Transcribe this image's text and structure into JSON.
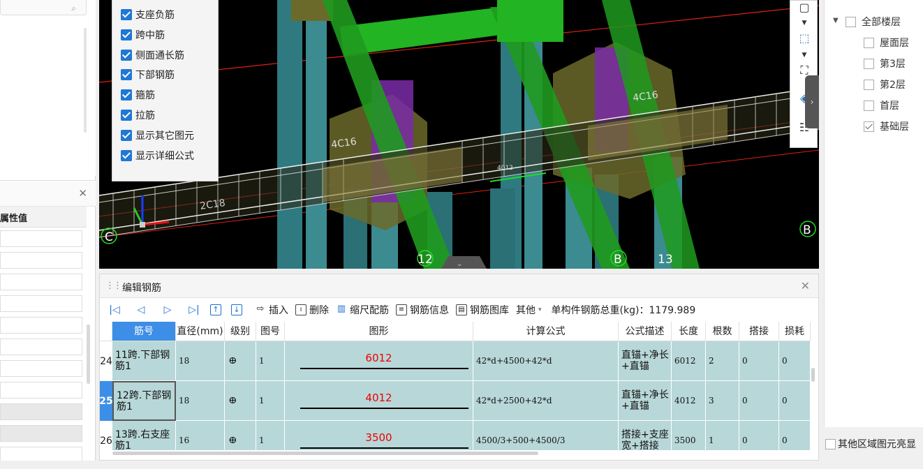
{
  "visibility_options": [
    "支座负筋",
    "跨中筋",
    "侧面通长筋",
    "下部钢筋",
    "箍筋",
    "拉筋",
    "显示其它图元",
    "显示详细公式"
  ],
  "properties_panel": {
    "column_header": "属性值"
  },
  "viewport": {
    "labels": {
      "rebar_top_left": "4C16",
      "rebar_top_right": "4C16",
      "rebar_bottom": "2C18",
      "mid_label": "4012",
      "axis_c": "C",
      "axis_b_right": "B",
      "axis_12": "12",
      "axis_b": "B",
      "axis_13": "13"
    }
  },
  "floor_tree": {
    "root": "全部楼层",
    "floors": [
      {
        "label": "屋面层",
        "checked": false
      },
      {
        "label": "第3层",
        "checked": false
      },
      {
        "label": "第2层",
        "checked": false
      },
      {
        "label": "首层",
        "checked": false
      },
      {
        "label": "基础层",
        "checked": true
      }
    ],
    "bottom_option": "其他区域图元亮显"
  },
  "rebar_panel": {
    "title": "编辑钢筋",
    "toolbar": {
      "insert": "插入",
      "delete": "删除",
      "scale": "缩尺配筋",
      "info": "钢筋信息",
      "library": "钢筋图库",
      "other": "其他",
      "total_weight": "单构件钢筋总重(kg)：1179.989"
    },
    "columns": [
      "筋号",
      "直径(mm)",
      "级别",
      "图号",
      "图形",
      "计算公式",
      "公式描述",
      "长度",
      "根数",
      "搭接",
      "损耗"
    ],
    "rows": [
      {
        "num": "24",
        "name": "11跨.下部钢筋1",
        "diameter": "18",
        "grade": "ⴲ",
        "fig": "1",
        "shape": "6012",
        "formula": "42*d+4500+42*d",
        "desc": "直锚+净长+直锚",
        "length": "6012",
        "count": "2",
        "lap": "0",
        "loss": "0"
      },
      {
        "num": "25",
        "name": "12跨.下部钢筋1",
        "diameter": "18",
        "grade": "ⴲ",
        "fig": "1",
        "shape": "4012",
        "formula": "42*d+2500+42*d",
        "desc": "直锚+净长+直锚",
        "length": "4012",
        "count": "3",
        "lap": "0",
        "loss": "0"
      },
      {
        "num": "26",
        "name": "13跨.右支座筋1",
        "diameter": "16",
        "grade": "ⴲ",
        "fig": "1",
        "shape": "3500",
        "formula": "4500/3+500+4500/3",
        "desc": "搭接+支座宽+搭接",
        "length": "3500",
        "count": "1",
        "lap": "0",
        "loss": "0"
      }
    ]
  }
}
